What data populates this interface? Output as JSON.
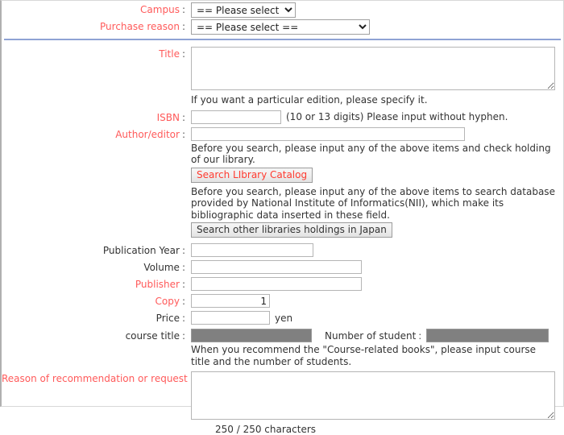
{
  "form": {
    "campus": {
      "label": "Campus",
      "colon": ":",
      "selected": "== Please select ==",
      "options": [
        "== Please select =="
      ],
      "required": true
    },
    "purchase_reason": {
      "label": "Purchase reason",
      "colon": ":",
      "selected": "== Please select ==",
      "options": [
        "== Please select =="
      ],
      "required": true
    },
    "title": {
      "label": "Title",
      "colon": ":",
      "value": "",
      "helper": "If you want a particular edition, please specify it.",
      "required": true
    },
    "isbn": {
      "label": "ISBN",
      "colon": ":",
      "value": "",
      "hint": "(10 or 13 digits) Please input without hyphen.",
      "required": true
    },
    "author_editor": {
      "label": "Author/editor",
      "colon": ":",
      "value": "",
      "required": true
    },
    "search_catalog": {
      "helper": "Before you search, please input any of the above items and check holding of our library.",
      "button_label": "Search LIbrary Catalog"
    },
    "search_nii": {
      "helper": "Before you search, please input any of the above items to search database provided by National Institute of Informatics(NII), which make its bibliographic data inserted in these field.",
      "button_label": "Search other libraries holdings in Japan"
    },
    "publication_year": {
      "label": "Publication Year",
      "colon": ":",
      "value": "",
      "required": false
    },
    "volume": {
      "label": "Volume",
      "colon": ":",
      "value": "",
      "required": false
    },
    "publisher": {
      "label": "Publisher",
      "colon": ":",
      "value": "",
      "required": true
    },
    "copy": {
      "label": "Copy",
      "colon": ":",
      "value": "1",
      "required": true
    },
    "price": {
      "label": "Price",
      "colon": ":",
      "value": "",
      "unit": "yen",
      "required": false
    },
    "course_title": {
      "label": "course title",
      "colon": ":",
      "value": "",
      "disabled": true,
      "required": false
    },
    "number_of_student": {
      "label": "Number of student",
      "colon": ":",
      "value": "",
      "disabled": true
    },
    "course_helper": "When you recommend the \"Course-related books\", please input course title and the number of students.",
    "reason": {
      "label": "Reason of recommendation or request",
      "colon": ":",
      "value": "",
      "required": true,
      "char_counter": "250 / 250 characters"
    }
  },
  "colors": {
    "required_label": "#ff5a5a",
    "optional_label": "#333333",
    "divider": "#8fa3d4",
    "disabled_field": "#808080",
    "button_red_text": "#ff3b30"
  }
}
